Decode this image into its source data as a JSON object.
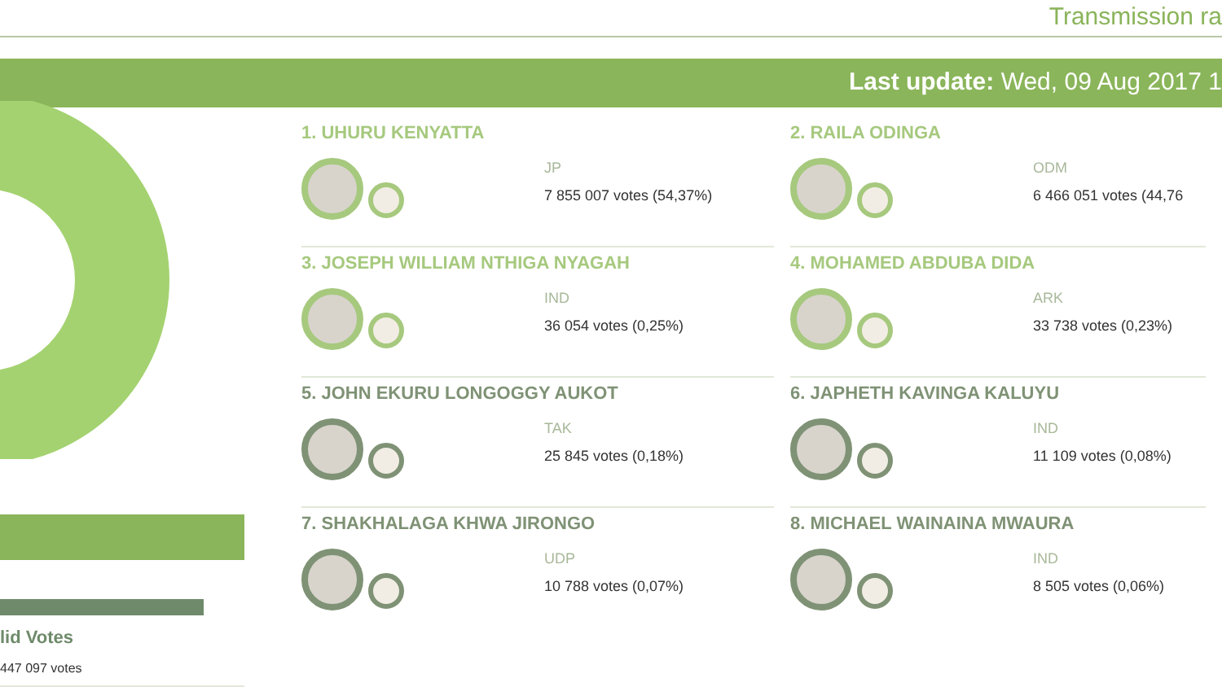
{
  "header": {
    "title": "Transmission ra"
  },
  "update_bar": {
    "label": "Last update:",
    "value": "Wed, 09 Aug 2017 1"
  },
  "summary": {
    "label": "lid Votes",
    "votes": "447 097 votes"
  },
  "candidates": [
    {
      "name": "1. UHURU KENYATTA",
      "party": "JP",
      "votes": "7 855 007 votes (54,37%)",
      "color": "#a6c97e"
    },
    {
      "name": "2. RAILA ODINGA",
      "party": "ODM",
      "votes": "6 466 051 votes (44,76",
      "color": "#a6c97e"
    },
    {
      "name": "3. JOSEPH WILLIAM NTHIGA NYAGAH",
      "party": "IND",
      "votes": "36 054 votes (0,25%)",
      "color": "#a6c97e"
    },
    {
      "name": "4. MOHAMED ABDUBA DIDA",
      "party": "ARK",
      "votes": "33 738 votes (0,23%)",
      "color": "#a6c97e"
    },
    {
      "name": "5. JOHN EKURU LONGOGGY AUKOT",
      "party": "TAK",
      "votes": "25 845 votes (0,18%)",
      "color": "#7f9275"
    },
    {
      "name": "6. JAPHETH KAVINGA KALUYU",
      "party": "IND",
      "votes": "11 109 votes (0,08%)",
      "color": "#7f9275"
    },
    {
      "name": "7. SHAKHALAGA KHWA JIRONGO",
      "party": "UDP",
      "votes": "10 788 votes (0,07%)",
      "color": "#7f9275"
    },
    {
      "name": "8. MICHAEL WAINAINA MWAURA",
      "party": "IND",
      "votes": "8 505 votes (0,06%)",
      "color": "#7f9275"
    }
  ]
}
